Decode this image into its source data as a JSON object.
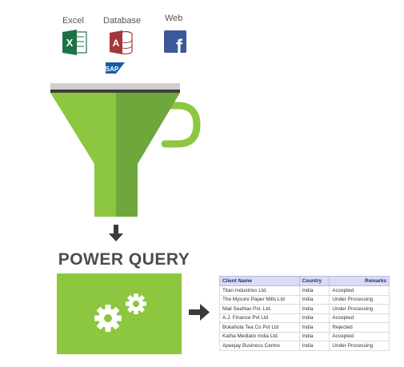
{
  "sources": {
    "excel_label": "Excel",
    "database_label": "Database",
    "web_label": "Web",
    "excel_icon_letter": "X",
    "database_icon_letter": "A",
    "web_icon_letter": "f",
    "sap_logo_text": "SAP"
  },
  "title": "POWER QUERY",
  "colors": {
    "funnel_light": "#8dc63f",
    "funnel_dark": "#6ea83a",
    "excel_green": "#1e7145",
    "access_red": "#a4373a",
    "facebook_blue": "#3b5998",
    "sap_blue": "#1a5ca8",
    "arrow": "#3a3a3a"
  },
  "table": {
    "headers": [
      "Client Name",
      "Country",
      "Remarks"
    ],
    "rows": [
      [
        "Titan Industries Ltd.",
        "India",
        "Accepted"
      ],
      [
        "The Mysore Paper Mills Ltd",
        "India",
        "Under Processing"
      ],
      [
        "Mail SeaNav Pvt. Ltd.",
        "India",
        "Under Processing"
      ],
      [
        "A.J. Finance Pvt Ltd",
        "India",
        "Accepted"
      ],
      [
        "Bokahola Tea Co Pvt Ltd",
        "India",
        "Rejected"
      ],
      [
        "Katha Mediatix India Ltd.",
        "India",
        "Accepted"
      ],
      [
        "Apeejay Business Centre",
        "India",
        "Under Processing"
      ]
    ]
  }
}
